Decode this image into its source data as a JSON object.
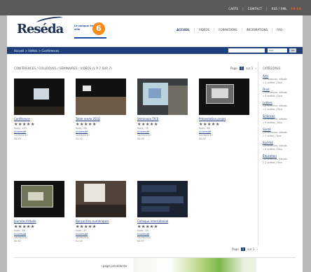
{
  "top_bar": {
    "links": [
      "CARTE",
      "CONTACT",
      "RSS / XML"
    ],
    "lang": "FR EN"
  },
  "header": {
    "logo_text": "Reséda",
    "badge_text": "Le campus en ville",
    "badge_number": "6",
    "nav": [
      "ACCUEIL",
      "VIDÉOS",
      "FORMATIONS",
      "INFORMATIONS",
      "FAQ"
    ]
  },
  "bluebar": {
    "breadcrumb": "Accueil > Vidéos > Conférences",
    "search_placeholder": "",
    "select_value": "Tout",
    "search_button": "OK"
  },
  "content": {
    "title": "CONFÉRENCES / COLLOQUES / SÉMINAIRES : VIDÉOS (1 À 7 SUR 7)",
    "pager": {
      "label": "Page",
      "current": "1",
      "of": "sur 1",
      "next": "›"
    },
    "videos": [
      {
        "title": "Conférence",
        "stars": "★★★★★",
        "views": "Vues : 125",
        "author": "Université",
        "date": "12/05/2010",
        "duration": "00:45"
      },
      {
        "title": "Table ronde 2010",
        "stars": "★★★★★",
        "views": "Vues : 98",
        "author": "Université",
        "date": "15/05/2010",
        "duration": "01:12"
      },
      {
        "title": "Séminaire TICE",
        "stars": "★★★★★",
        "views": "Vues : 76",
        "author": "Université",
        "date": "20/05/2010",
        "duration": "00:38"
      },
      {
        "title": "Présentation projet",
        "stars": "★★★★★",
        "views": "Vues : 64",
        "author": "Université",
        "date": "02/06/2010",
        "duration": "00:52"
      },
      {
        "title": "Journée d'étude",
        "stars": "★★★★★",
        "views": "Vues : 58",
        "author": "Université",
        "date": "10/06/2010",
        "duration": "00:41"
      },
      {
        "title": "Rencontres numériques",
        "stars": "★★★★★",
        "views": "Vues : 47",
        "author": "Université",
        "date": "18/06/2010",
        "duration": "01:05"
      },
      {
        "title": "Colloque international",
        "stars": "★★★★★",
        "views": "Vues : 39",
        "author": "Université",
        "date": "25/06/2010",
        "duration": "00:57"
      }
    ]
  },
  "sidebar": {
    "title": "CATÉGORIES",
    "items": [
      {
        "heading": "Arts",
        "desc1": "Conférences, débats",
        "desc2": "» 4 vidéos | Tous"
      },
      {
        "heading": "Droit",
        "desc1": "Conférences, débats",
        "desc2": "» 3 vidéos | Tous"
      },
      {
        "heading": "Lettres",
        "desc1": "Conférences, débats",
        "desc2": "» 2 vidéos | Tous"
      },
      {
        "heading": "Sciences",
        "desc1": "Conférences, débats",
        "desc2": "» 5 vidéos | Tous"
      },
      {
        "heading": "Santé",
        "desc1": "Conférences, débats",
        "desc2": "» 1 vidéo | Tous"
      },
      {
        "heading": "Société",
        "desc1": "Conférences, débats",
        "desc2": "» 6 vidéos | Tous"
      },
      {
        "heading": "Éducation",
        "desc1": "Conférences, débats",
        "desc2": "» 2 vidéos | Tous"
      }
    ]
  },
  "footer": {
    "link": "‹ page précédente"
  }
}
